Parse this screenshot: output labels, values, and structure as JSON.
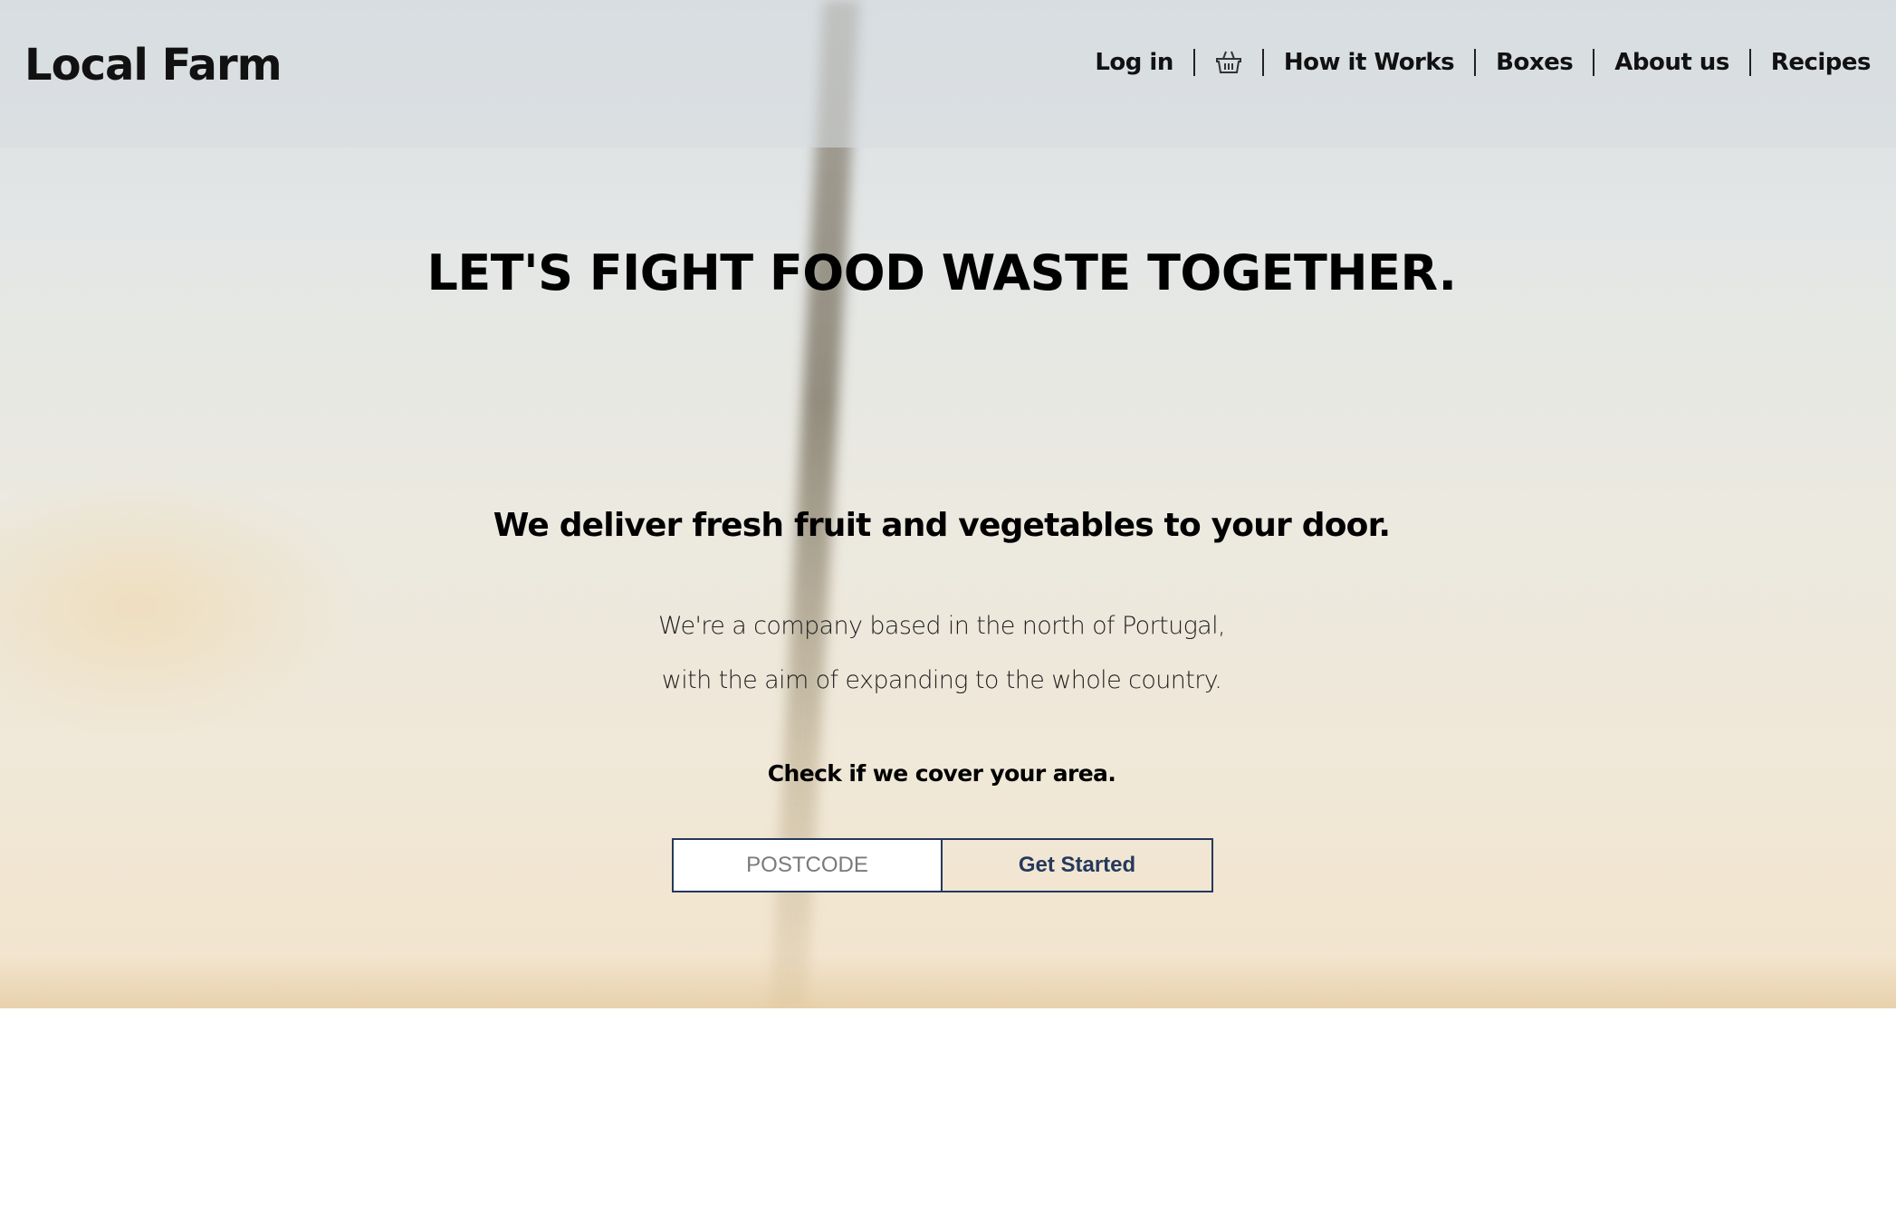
{
  "header": {
    "logo": "Local Farm",
    "nav": {
      "login": "Log in",
      "basket_icon": "basket-icon",
      "how_it_works": "How it Works",
      "boxes": "Boxes",
      "about_us": "About us",
      "recipes": "Recipes"
    }
  },
  "hero": {
    "title": "LET'S FIGHT FOOD WASTE TOGETHER.",
    "subtitle": "We deliver fresh fruit and vegetables to your door.",
    "description_line1": "We're a company based in the north of Portugal,",
    "description_line2": "with the aim of expanding to the whole country.",
    "cta_text": "Check if we cover your area.",
    "postcode_placeholder": "POSTCODE",
    "postcode_value": "",
    "get_started_label": "Get Started"
  },
  "colors": {
    "accent": "#24395c"
  }
}
